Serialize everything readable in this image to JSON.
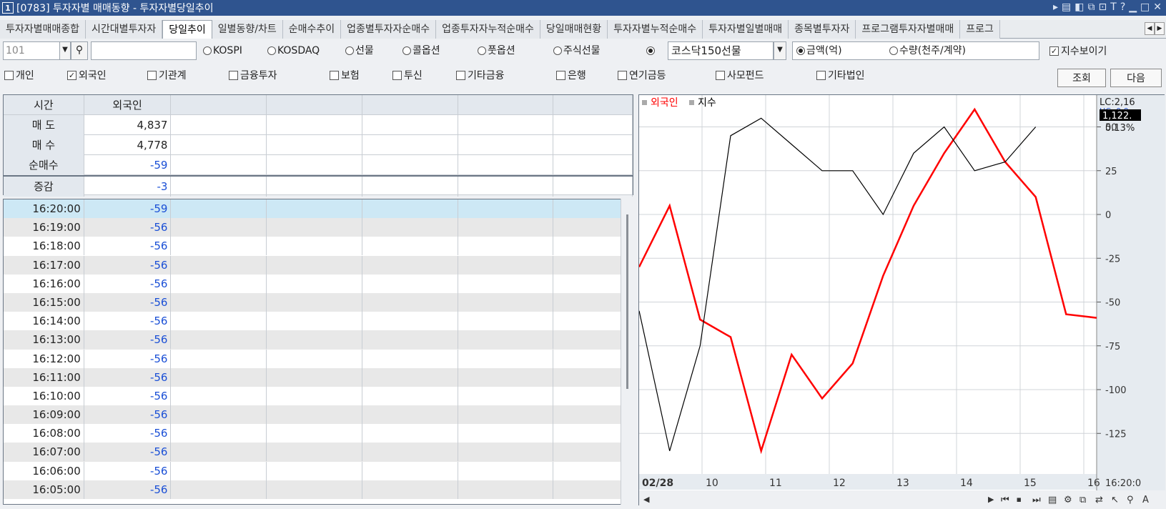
{
  "window": {
    "num": "1",
    "title": "[0783] 투자자별 매매동향 - 투자자별당일추이"
  },
  "tabs": [
    "투자자별매매종합",
    "시간대별투자자",
    "당일추이",
    "일별동향/차트",
    "순매수추이",
    "업종별투자자순매수",
    "업종투자자누적순매수",
    "당일매매현황",
    "투자자별누적순매수",
    "투자자별일별매매",
    "종목별투자자",
    "프로그램투자자별매매",
    "프로그"
  ],
  "active_tab": 2,
  "code_input": {
    "value": "101"
  },
  "market_radios": [
    "KOSPI",
    "KOSDAQ",
    "선물",
    "콜옵션",
    "풋옵션",
    "주식선물"
  ],
  "future_select": {
    "value": "코스닥150선물"
  },
  "unit_radios": {
    "amount": "금액(억)",
    "qty": "수량(천주/계약)"
  },
  "show_index": "지수보이기",
  "investors": [
    "개인",
    "외국인",
    "기관계",
    "금융투자",
    "보험",
    "투신",
    "기타금융",
    "은행",
    "연기금등",
    "사모펀드",
    "기타법인"
  ],
  "checked_investor": "외국인",
  "buttons": {
    "query": "조회",
    "next": "다음"
  },
  "summary": {
    "headers": [
      "시간",
      "외국인"
    ],
    "rows": [
      {
        "label": "매 도",
        "value": "4,837"
      },
      {
        "label": "매 수",
        "value": "4,778"
      },
      {
        "label": "순매수",
        "value": "-59"
      },
      {
        "label": "증감",
        "value": "-3"
      }
    ]
  },
  "timeline": [
    {
      "time": "16:20:00",
      "value": "-59"
    },
    {
      "time": "16:19:00",
      "value": "-56"
    },
    {
      "time": "16:18:00",
      "value": "-56"
    },
    {
      "time": "16:17:00",
      "value": "-56"
    },
    {
      "time": "16:16:00",
      "value": "-56"
    },
    {
      "time": "16:15:00",
      "value": "-56"
    },
    {
      "time": "16:14:00",
      "value": "-56"
    },
    {
      "time": "16:13:00",
      "value": "-56"
    },
    {
      "time": "16:12:00",
      "value": "-56"
    },
    {
      "time": "16:11:00",
      "value": "-56"
    },
    {
      "time": "16:10:00",
      "value": "-56"
    },
    {
      "time": "16:09:00",
      "value": "-56"
    },
    {
      "time": "16:08:00",
      "value": "-56"
    },
    {
      "time": "16:07:00",
      "value": "-56"
    },
    {
      "time": "16:06:00",
      "value": "-56"
    },
    {
      "time": "16:05:00",
      "value": "-56"
    }
  ],
  "chart": {
    "legend": [
      "외국인",
      "지수"
    ],
    "top_labels": {
      "lc": "LC:2,16",
      "hc": "HC: 0.0",
      "price": "1,122.",
      "pct": "0.13%"
    },
    "y_ticks": [
      "50",
      "25",
      "0",
      "-25",
      "-50",
      "-75",
      "-100",
      "-125"
    ],
    "x_ticks": [
      "02/28",
      "10",
      "11",
      "12",
      "13",
      "14",
      "15",
      "16"
    ],
    "time_label": "16:20:0",
    "colors": {
      "foreign": "#ff0000",
      "index": "#000000"
    }
  },
  "chart_data": {
    "type": "line",
    "x": [
      "09:00",
      "09:30",
      "10:00",
      "10:30",
      "11:00",
      "11:30",
      "12:00",
      "12:30",
      "13:00",
      "13:30",
      "14:00",
      "14:30",
      "15:00",
      "15:30",
      "16:00",
      "16:20"
    ],
    "series": [
      {
        "name": "외국인",
        "values": [
          -30,
          5,
          -60,
          -70,
          -135,
          -80,
          -105,
          -85,
          -35,
          5,
          35,
          60,
          30,
          10,
          -57,
          -59
        ]
      },
      {
        "name": "지수",
        "values": [
          -55,
          -135,
          -75,
          45,
          55,
          40,
          25,
          25,
          0,
          35,
          50,
          25,
          30,
          50,
          null,
          null
        ]
      }
    ],
    "ylim": [
      -140,
      60
    ],
    "xlabel": "",
    "ylabel": ""
  }
}
